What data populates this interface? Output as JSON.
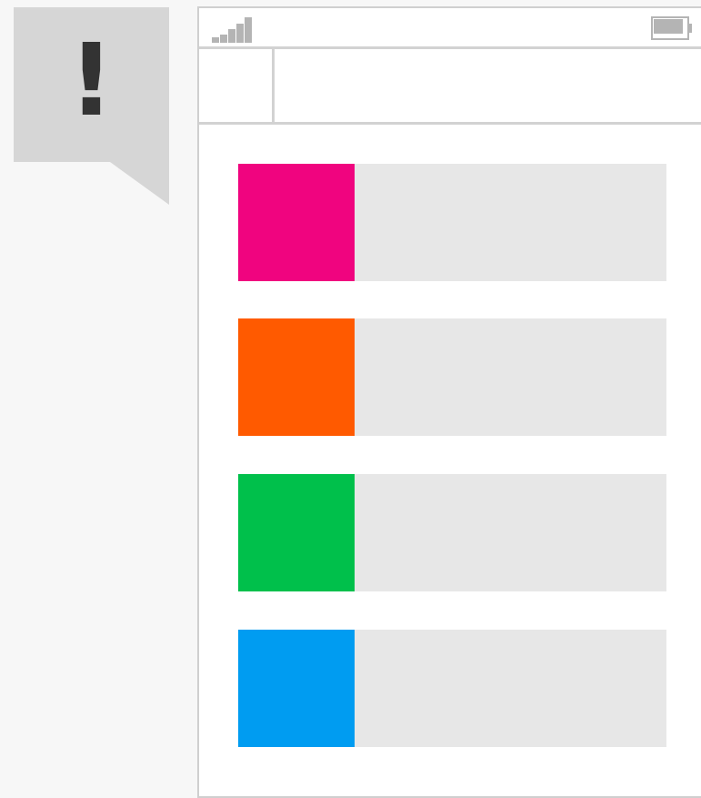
{
  "notice": {
    "symbol": "!"
  },
  "status_bar": {
    "signal_icon": "signal-strength-icon",
    "signal_bars": 5,
    "battery_icon": "battery-icon",
    "battery_level": 1.0
  },
  "app_bar": {
    "title": "",
    "button_label": ""
  },
  "list": {
    "items": [
      {
        "color": "#f0047f",
        "label": ""
      },
      {
        "color": "#ff5a00",
        "label": ""
      },
      {
        "color": "#00c04b",
        "label": ""
      },
      {
        "color": "#009cf1",
        "label": ""
      }
    ]
  },
  "colors": {
    "background": "#f7f7f7",
    "bubble": "#d6d6d6",
    "bubble_text": "#333333",
    "phone_border": "#cfcfcf",
    "divider": "#d2d2d2",
    "icon": "#b4b4b4",
    "list_item_background": "#e7e7e7"
  }
}
